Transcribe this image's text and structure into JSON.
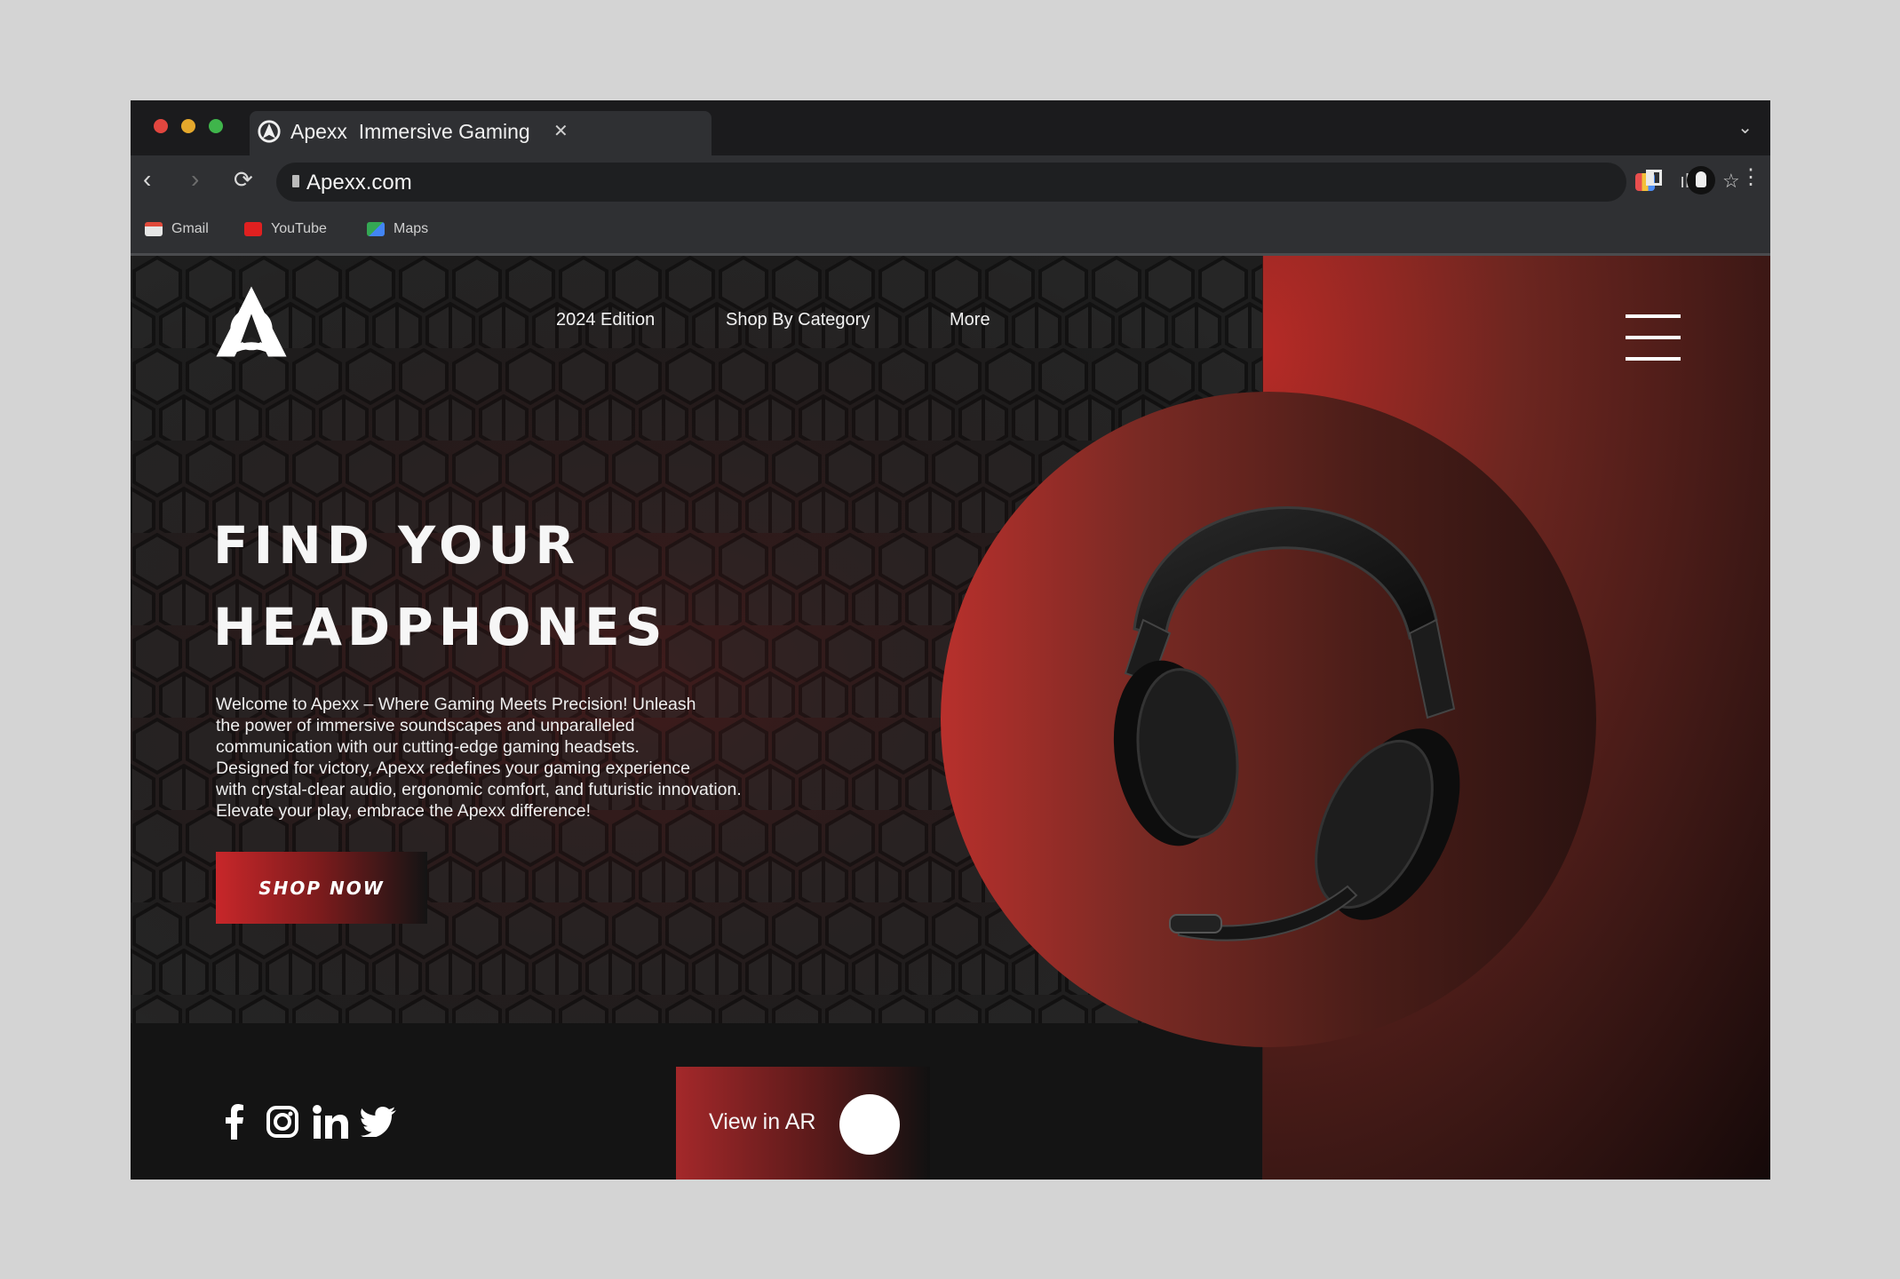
{
  "browser": {
    "tab": {
      "brand": "Apexx",
      "title": "Immersive Gaming"
    },
    "url": "Apexx.com",
    "bookmarks": [
      {
        "label": "Gmail",
        "icon": "gmail-icon"
      },
      {
        "label": "YouTube",
        "icon": "youtube-icon"
      },
      {
        "label": "Maps",
        "icon": "maps-icon"
      }
    ]
  },
  "nav": {
    "items": [
      "2024 Edition",
      "Shop By Category",
      "More"
    ]
  },
  "hero": {
    "title_line1": "Find Your",
    "title_line2": "Headphones",
    "description_lines": [
      "Welcome to Apexx – Where Gaming Meets Precision! Unleash",
      "the power of immersive soundscapes and unparalleled",
      "communication with our cutting-edge gaming headsets.",
      "Designed for victory, Apexx redefines your gaming experience",
      "with crystal-clear audio, ergonomic comfort, and futuristic innovation.",
      "Elevate your play, embrace the Apexx difference!"
    ],
    "cta": "Shop Now"
  },
  "ar": {
    "label": "View in AR"
  },
  "socials": [
    "facebook-icon",
    "instagram-icon",
    "linkedin-icon",
    "twitter-icon"
  ],
  "colors": {
    "accent": "#c8272a",
    "dark": "#141414"
  }
}
